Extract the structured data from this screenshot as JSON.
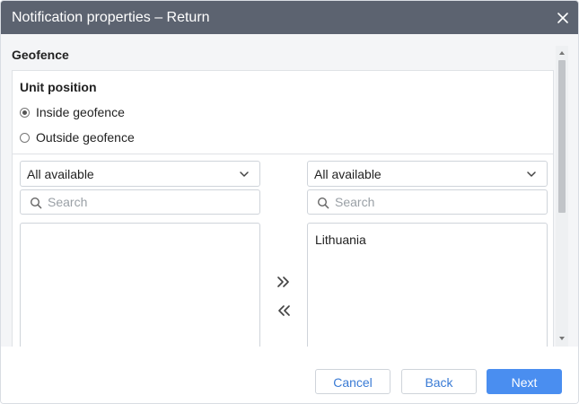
{
  "dialog": {
    "title": "Notification properties – Return"
  },
  "section": {
    "title": "Geofence"
  },
  "unit_position": {
    "title": "Unit position",
    "options": [
      {
        "label": "Inside geofence",
        "checked": true
      },
      {
        "label": "Outside geofence",
        "checked": false
      }
    ]
  },
  "left_pane": {
    "filter": "All available",
    "search_placeholder": "Search",
    "items": []
  },
  "right_pane": {
    "filter": "All available",
    "search_placeholder": "Search",
    "items": [
      "Lithuania"
    ]
  },
  "footer": {
    "cancel_label": "Cancel",
    "back_label": "Back",
    "next_label": "Next"
  },
  "colors": {
    "titlebar": "#5c6370",
    "primary": "#4a8ef0",
    "link": "#3a7bd5"
  }
}
